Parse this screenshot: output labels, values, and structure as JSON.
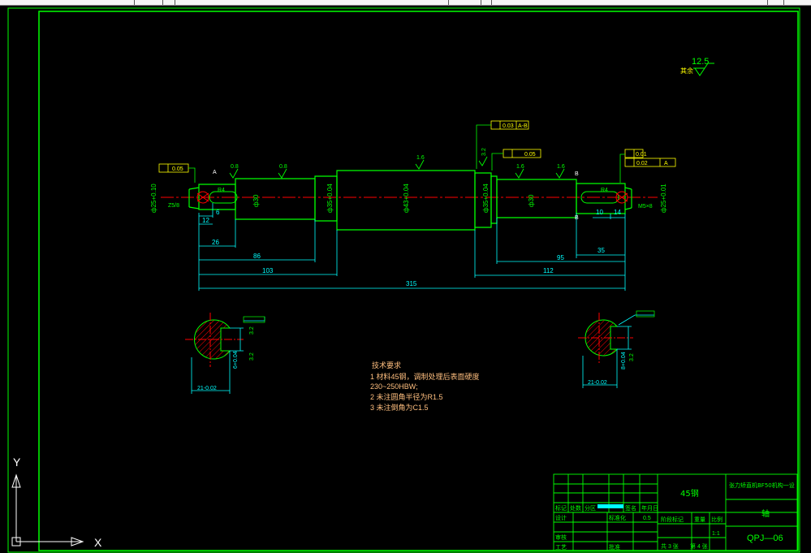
{
  "roughness_general": {
    "value": "12.5",
    "label": "其余"
  },
  "dims": {
    "d_left_end": "ф25+0.10",
    "d_small_a": "ф30",
    "d_left_bearing": "ф35+0.04",
    "d_middle": "ф43+0.04",
    "d_right_bearing": "ф35+0.04",
    "d_small_b": "ф30",
    "d_right_end": "ф25+0.01",
    "len_12": "12",
    "len_6": "6",
    "len_26": "26",
    "len_86": "86",
    "len_103": "103",
    "len_315": "315",
    "len_10": "10",
    "len_14": "14",
    "len_35": "35",
    "len_95": "95",
    "len_112": "112",
    "thread_left": "Z5/8",
    "thread_right": "M5×8",
    "keyway_r": "R4",
    "keyway_r2": "R4"
  },
  "roughness": {
    "r1": "0.8",
    "r2": "0.8",
    "r3": "1.6",
    "r4": "1.6",
    "r5": "1.6",
    "r6": "3.2",
    "r7": "1.6",
    "r8": "1.6"
  },
  "tolerances": {
    "t_flat_left": "0.05",
    "t_parallel": "0.05",
    "t_runout_top": "0.03",
    "t_runout_top_ref": "A-B",
    "t_cyl_right": "0.01",
    "t_runout_right": "0.02",
    "t_runout_right_ref": "A",
    "t_key_right": "0.01"
  },
  "datums": {
    "a": "A",
    "b": "B",
    "c": "B"
  },
  "sections": {
    "left_width": "21-0.02",
    "left_depth": "6+0.04",
    "left_rough1": "3.2",
    "left_rough2": "3.2",
    "right_width": "21-0.02",
    "right_depth": "8+0.04",
    "right_rough": "3.2"
  },
  "tech_req": {
    "title": "技术要求",
    "line1": "1 材料45钢，调制处理后表面硬度",
    "line2": "230~250HBW;",
    "line3": "2 未注圆角半径为R1.5",
    "line4": "3 未注倒角为C1.5"
  },
  "title_block": {
    "material": "45钢",
    "company": "张力矫直机BF50机构一设",
    "part_name": "轴",
    "drawing_no": "QPJ—06",
    "scale": "1:1",
    "scale_label": "比例",
    "weight_label": "重量",
    "stage_label": "阶段标记",
    "mark_label": "标记",
    "count_label": "处数",
    "zone_label": "分区",
    "change_label": "更改文件号",
    "sign_label": "签名",
    "date_label": "年月日",
    "design_label": "设计",
    "std_label": "标准化",
    "review_label": "审核",
    "process_label": "工艺",
    "approve_label": "批准",
    "sheet_total": "共 3 张",
    "sheet_no": "第 4 张",
    "date_val": "0.5"
  },
  "ucs": {
    "x": "X",
    "y": "Y"
  },
  "colors": {
    "frame": "#00ff00",
    "dim": "#00ffff",
    "part": "#00ff00",
    "center": "#ff0000",
    "hatch": "#ff0000",
    "tolerance": "#ffff00",
    "text_tech": "#ffbf7f",
    "ucs": "#ffffff"
  }
}
